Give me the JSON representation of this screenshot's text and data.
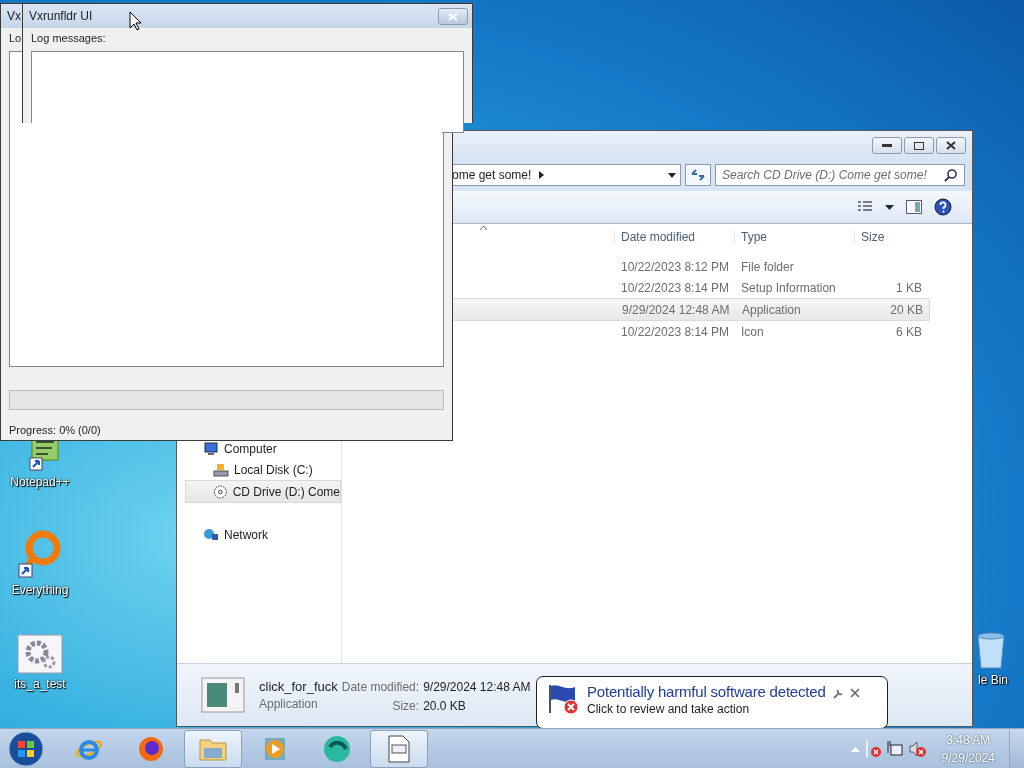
{
  "back_window": {
    "title": "Vx",
    "label": "Lo",
    "progress": {
      "level": 0
    },
    "progress_text": "Progress: 0% (0/0)"
  },
  "front_window": {
    "title": "Vxrunfldr UI",
    "label": "Log messages:"
  },
  "explorer": {
    "address": "ome get some!",
    "search": {
      "placeholder": "Search CD Drive (D:) Come get some!"
    },
    "columns": [
      "Date modified",
      "Type",
      "Size"
    ],
    "rows": [
      {
        "date": "10/22/2023 8:12 PM",
        "type": "File folder",
        "selected": false
      },
      {
        "date": "10/22/2023 8:14 PM",
        "type": "Setup Information",
        "size": "1 KB",
        "selected": false
      },
      {
        "date": "9/29/2024 12:48 AM",
        "type": "Application",
        "size": "20 KB",
        "selected": true
      },
      {
        "date": "10/22/2023 8:14 PM",
        "type": "Icon",
        "size": "6 KB",
        "selected": false
      }
    ],
    "nav": [
      {
        "label": "Computer",
        "kind": "computer",
        "selected": false,
        "children": [
          {
            "label": "Local Disk (C:)",
            "kind": "disk",
            "selected": false
          },
          {
            "label": "CD Drive (D:) Come",
            "kind": "cd",
            "selected": true
          }
        ]
      },
      {
        "label": "Network",
        "kind": "network",
        "selected": false
      }
    ],
    "details": {
      "name": "click_for_fuck",
      "type": "Application",
      "date_label": "Date modified:",
      "date": "9/29/2024 12:48 AM",
      "size_label": "Size:",
      "size": "20.0 KB"
    }
  },
  "desktop_icons": [
    {
      "label": "Notepad++",
      "kind": "notepad"
    },
    {
      "label": "Everything",
      "kind": "everything"
    },
    {
      "label": "its_a_test",
      "kind": "settings"
    },
    {
      "label": "le Bin",
      "kind": "bin"
    }
  ],
  "notification": {
    "title": "Potentially harmful software detected",
    "text": "Click to review and take action"
  },
  "taskbar": {
    "apps": [
      {
        "kind": "ie",
        "active": false
      },
      {
        "kind": "firefox",
        "active": false
      },
      {
        "kind": "explorer",
        "active": true
      },
      {
        "kind": "media",
        "active": false
      },
      {
        "kind": "green",
        "active": false
      },
      {
        "kind": "document",
        "active": true
      }
    ],
    "time": "3:48 AM",
    "date": "9/29/2024"
  }
}
